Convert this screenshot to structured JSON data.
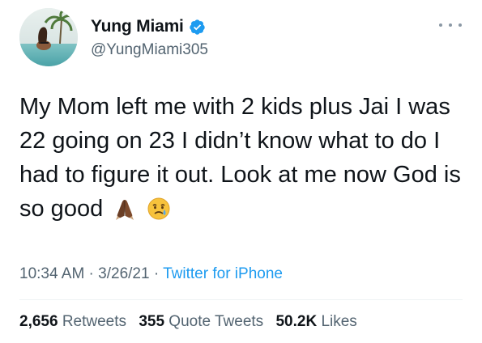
{
  "user": {
    "display_name": "Yung Miami",
    "handle": "@YungMiami305",
    "verified": true
  },
  "tweet": {
    "text": "My Mom left me with 2 kids plus Jai I was 22 going on 23 I didn’t know what to do I had to figure it out. Look at me now God is so good",
    "emojis": [
      "folded-hands-emoji",
      "crying-face-emoji"
    ]
  },
  "meta": {
    "time": "10:34 AM",
    "separator1": " · ",
    "date": "3/26/21",
    "separator2": " · ",
    "source": "Twitter for iPhone"
  },
  "stats": {
    "retweets_count": "2,656",
    "retweets_label": "Retweets",
    "quotes_count": "355",
    "quotes_label": "Quote Tweets",
    "likes_count": "50.2K",
    "likes_label": "Likes"
  },
  "colors": {
    "verified": "#1d9bf0",
    "link": "#1d9bf0",
    "secondary_text": "#536471"
  }
}
